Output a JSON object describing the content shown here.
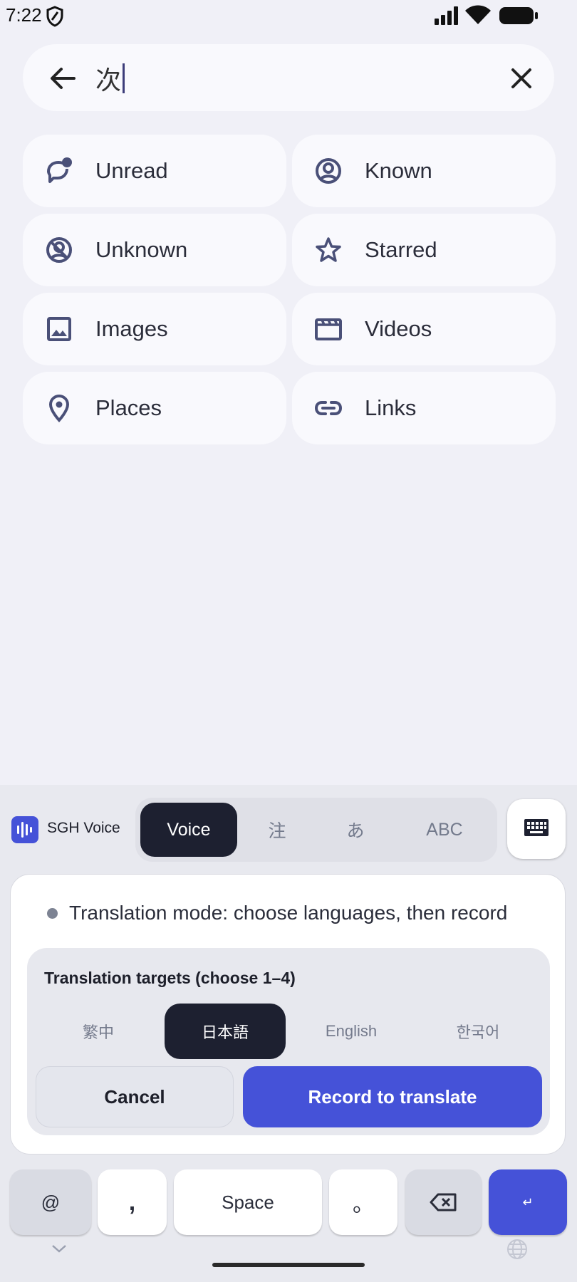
{
  "status_bar": {
    "time": "7:22"
  },
  "search": {
    "query": "次"
  },
  "filters": [
    {
      "label": "Unread",
      "icon": "unread-chat-icon"
    },
    {
      "label": "Known",
      "icon": "person-circle-icon"
    },
    {
      "label": "Unknown",
      "icon": "person-off-icon"
    },
    {
      "label": "Starred",
      "icon": "star-icon"
    },
    {
      "label": "Images",
      "icon": "image-icon"
    },
    {
      "label": "Videos",
      "icon": "video-clapper-icon"
    },
    {
      "label": "Places",
      "icon": "location-pin-icon"
    },
    {
      "label": "Links",
      "icon": "link-icon"
    }
  ],
  "keyboard": {
    "brand": "SGH Voice",
    "modes": [
      "Voice",
      "注",
      "あ",
      "ABC"
    ],
    "selected_mode": "Voice",
    "status_text": "Translation mode: choose languages, then record",
    "targets_title": "Translation targets (choose 1–4)",
    "languages": [
      "繁中",
      "日本語",
      "English",
      "한국어"
    ],
    "selected_language": "日本語",
    "cancel_label": "Cancel",
    "record_label": "Record to translate",
    "keys": {
      "at": "@",
      "comma": ",",
      "space": "Space",
      "period": "。",
      "enter": "↵"
    }
  },
  "colors": {
    "accent": "#4552d8",
    "dark": "#1d2030",
    "background": "#f0f0f7",
    "chip": "#f9f9fd"
  }
}
